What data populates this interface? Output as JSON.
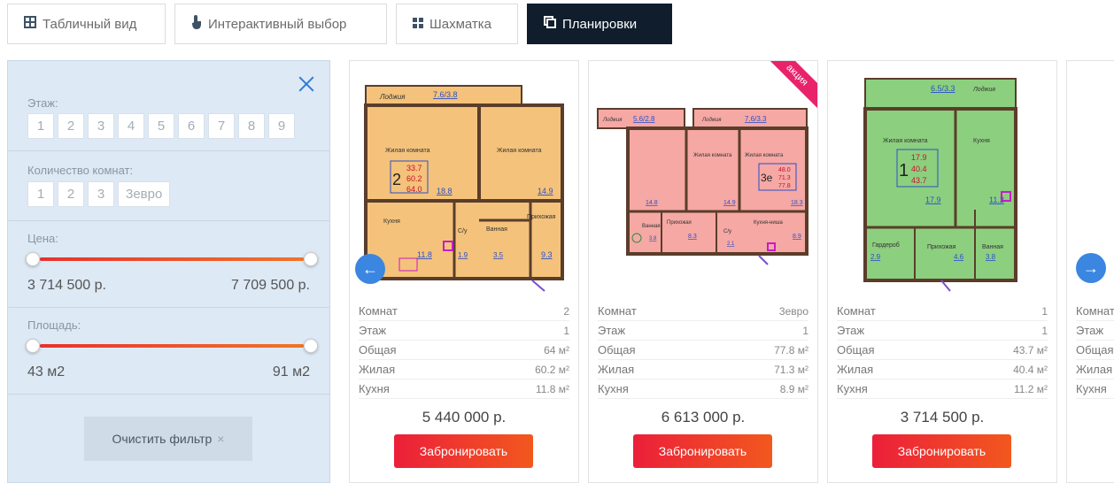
{
  "tabs": [
    {
      "label": "Табличный вид",
      "icon": "table-icon"
    },
    {
      "label": "Интерактивный выбор",
      "icon": "touch-icon"
    },
    {
      "label": "Шахматка",
      "icon": "grid-icon"
    },
    {
      "label": "Планировки",
      "icon": "layout-icon",
      "active": true
    }
  ],
  "filter": {
    "floor_label": "Этаж:",
    "floors": [
      "1",
      "2",
      "3",
      "4",
      "5",
      "6",
      "7",
      "8",
      "9"
    ],
    "rooms_label": "Количество комнат:",
    "rooms": [
      "1",
      "2",
      "3",
      "3евро"
    ],
    "price_label": "Цена:",
    "price_min": "3 714 500 р.",
    "price_max": "7 709 500 р.",
    "area_label": "Площадь:",
    "area_min": "43 м2",
    "area_max": "91 м2",
    "clear_label": "Очистить фильтр",
    "clear_x": "×"
  },
  "cards": [
    {
      "rooms_label": "Комнат",
      "rooms": "2",
      "floor_label": "Этаж",
      "floor": "1",
      "total_label": "Общая",
      "total": "64 м²",
      "living_label": "Жилая",
      "living": "60.2 м²",
      "kitchen_label": "Кухня",
      "kitchen": "11.8 м²",
      "price": "5 440 000 р.",
      "book": "Забронировать",
      "plan": {
        "color": "#f4c27a",
        "balcony": "Лоджия",
        "balcony_area": "7.6/3.8",
        "room1": "Жилая комната",
        "room2": "Жилая комната",
        "kitchen": "Кухня",
        "hall": "Прихожая",
        "wc": "С/у",
        "bath": "Ванная",
        "n": "2",
        "a1": "33.7",
        "a2": "60.2",
        "a3": "64.0",
        "r1": "18.8",
        "r2": "14.9",
        "k": "11.8",
        "h": "9.3",
        "w": "1.9",
        "b": "3.5"
      }
    },
    {
      "rooms_label": "Комнат",
      "rooms": "3евро",
      "floor_label": "Этаж",
      "floor": "1",
      "total_label": "Общая",
      "total": "77.8 м²",
      "living_label": "Жилая",
      "living": "71.3 м²",
      "kitchen_label": "Кухня",
      "kitchen": "8.9 м²",
      "price": "6 613 000 р.",
      "book": "Забронировать",
      "promo": "акция",
      "plan": {
        "color": "#f5a8a4",
        "balcony": "Лоджия",
        "balcony_area": "5.6/2.8",
        "balcony2": "Лоджия",
        "balcony2_area": "7.6/3.3",
        "room1": "Жилая комната",
        "room2": "Жилая комната",
        "n": "3е",
        "a1": "48.0",
        "a2": "71.3",
        "a3": "77.8",
        "r1": "14.8",
        "r2": "14.9",
        "r3": "18.3",
        "hall": "Прихожая",
        "kitchen": "Кухня-ниша",
        "k": "8.9",
        "h": "8.3",
        "wc": "С/у",
        "w": "2.1",
        "bath": "Ванная",
        "b": "3.8"
      }
    },
    {
      "rooms_label": "Комнат",
      "rooms": "1",
      "floor_label": "Этаж",
      "floor": "1",
      "total_label": "Общая",
      "total": "43.7 м²",
      "living_label": "Жилая",
      "living": "40.4 м²",
      "kitchen_label": "Кухня",
      "kitchen": "11.2 м²",
      "price": "3 714 500 р.",
      "book": "Забронировать",
      "plan": {
        "color": "#8ccf7e",
        "balcony": "Лоджия",
        "balcony_area": "6.5/3.3",
        "room1": "Жилая комната",
        "kitchen": "Кухня",
        "n": "1",
        "a1": "17.9",
        "a2": "40.4",
        "a3": "43.7",
        "r1": "17.9",
        "k": "11.2",
        "wardrobe": "Гардероб",
        "wa": "2.9",
        "hall": "Прихожая",
        "h": "4.6",
        "bath": "Ванная",
        "b": "3.8"
      }
    }
  ],
  "partial_card": {
    "rooms_label": "Комнат",
    "floor_label": "Этаж",
    "total_label": "Общая",
    "living_label": "Жилая",
    "kitchen_label": "Кухня"
  },
  "nav": {
    "prev": "←",
    "next": "→"
  }
}
